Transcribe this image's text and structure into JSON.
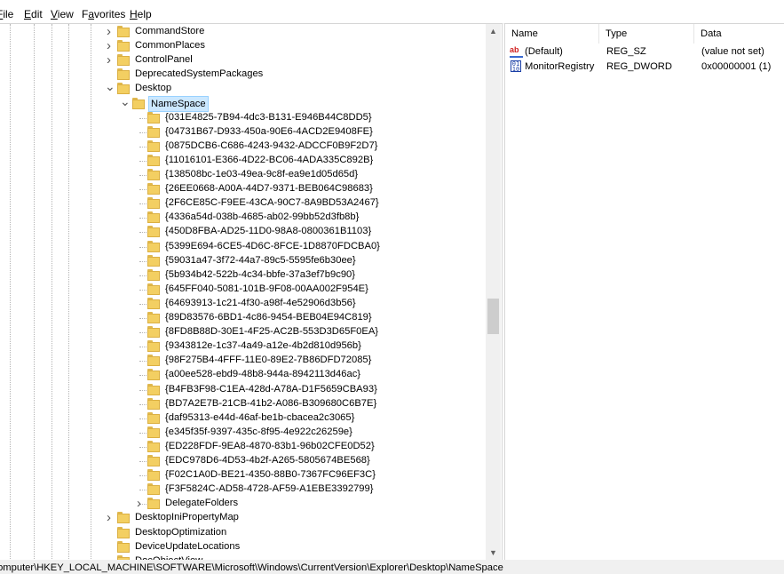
{
  "menu": [
    {
      "label": "File",
      "accel": "F"
    },
    {
      "label": "Edit",
      "accel": "E"
    },
    {
      "label": "View",
      "accel": "V"
    },
    {
      "label": "Favorites",
      "accel": "a"
    },
    {
      "label": "Help",
      "accel": "H"
    }
  ],
  "tree": {
    "items": [
      {
        "label": "CommandStore",
        "level": 0,
        "expander": "collapsed"
      },
      {
        "label": "CommonPlaces",
        "level": 0,
        "expander": "collapsed"
      },
      {
        "label": "ControlPanel",
        "level": 0,
        "expander": "collapsed"
      },
      {
        "label": "DeprecatedSystemPackages",
        "level": 0,
        "expander": "none"
      },
      {
        "label": "Desktop",
        "level": 0,
        "expander": "expanded"
      },
      {
        "label": "NameSpace",
        "level": 1,
        "expander": "expanded",
        "selected": true
      },
      {
        "label": "{031E4825-7B94-4dc3-B131-E946B44C8DD5}",
        "level": 2,
        "expander": "none"
      },
      {
        "label": "{04731B67-D933-450a-90E6-4ACD2E9408FE}",
        "level": 2,
        "expander": "none"
      },
      {
        "label": "{0875DCB6-C686-4243-9432-ADCCF0B9F2D7}",
        "level": 2,
        "expander": "none"
      },
      {
        "label": "{11016101-E366-4D22-BC06-4ADA335C892B}",
        "level": 2,
        "expander": "none"
      },
      {
        "label": "{138508bc-1e03-49ea-9c8f-ea9e1d05d65d}",
        "level": 2,
        "expander": "none"
      },
      {
        "label": "{26EE0668-A00A-44D7-9371-BEB064C98683}",
        "level": 2,
        "expander": "none"
      },
      {
        "label": "{2F6CE85C-F9EE-43CA-90C7-8A9BD53A2467}",
        "level": 2,
        "expander": "none"
      },
      {
        "label": "{4336a54d-038b-4685-ab02-99bb52d3fb8b}",
        "level": 2,
        "expander": "none"
      },
      {
        "label": "{450D8FBA-AD25-11D0-98A8-0800361B1103}",
        "level": 2,
        "expander": "none"
      },
      {
        "label": "{5399E694-6CE5-4D6C-8FCE-1D8870FDCBA0}",
        "level": 2,
        "expander": "none"
      },
      {
        "label": "{59031a47-3f72-44a7-89c5-5595fe6b30ee}",
        "level": 2,
        "expander": "none"
      },
      {
        "label": "{5b934b42-522b-4c34-bbfe-37a3ef7b9c90}",
        "level": 2,
        "expander": "none"
      },
      {
        "label": "{645FF040-5081-101B-9F08-00AA002F954E}",
        "level": 2,
        "expander": "none"
      },
      {
        "label": "{64693913-1c21-4f30-a98f-4e52906d3b56}",
        "level": 2,
        "expander": "none"
      },
      {
        "label": "{89D83576-6BD1-4c86-9454-BEB04E94C819}",
        "level": 2,
        "expander": "none"
      },
      {
        "label": "{8FD8B88D-30E1-4F25-AC2B-553D3D65F0EA}",
        "level": 2,
        "expander": "none"
      },
      {
        "label": "{9343812e-1c37-4a49-a12e-4b2d810d956b}",
        "level": 2,
        "expander": "none"
      },
      {
        "label": "{98F275B4-4FFF-11E0-89E2-7B86DFD72085}",
        "level": 2,
        "expander": "none"
      },
      {
        "label": "{a00ee528-ebd9-48b8-944a-8942113d46ac}",
        "level": 2,
        "expander": "none"
      },
      {
        "label": "{B4FB3F98-C1EA-428d-A78A-D1F5659CBA93}",
        "level": 2,
        "expander": "none"
      },
      {
        "label": "{BD7A2E7B-21CB-41b2-A086-B309680C6B7E}",
        "level": 2,
        "expander": "none"
      },
      {
        "label": "{daf95313-e44d-46af-be1b-cbacea2c3065}",
        "level": 2,
        "expander": "none"
      },
      {
        "label": "{e345f35f-9397-435c-8f95-4e922c26259e}",
        "level": 2,
        "expander": "none"
      },
      {
        "label": "{ED228FDF-9EA8-4870-83b1-96b02CFE0D52}",
        "level": 2,
        "expander": "none"
      },
      {
        "label": "{EDC978D6-4D53-4b2f-A265-5805674BE568}",
        "level": 2,
        "expander": "none"
      },
      {
        "label": "{F02C1A0D-BE21-4350-88B0-7367FC96EF3C}",
        "level": 2,
        "expander": "none"
      },
      {
        "label": "{F3F5824C-AD58-4728-AF59-A1EBE3392799}",
        "level": 2,
        "expander": "none"
      },
      {
        "label": "DelegateFolders",
        "level": 2,
        "expander": "collapsed"
      },
      {
        "label": "DesktopIniPropertyMap",
        "level": 0,
        "expander": "collapsed"
      },
      {
        "label": "DesktopOptimization",
        "level": 0,
        "expander": "none"
      },
      {
        "label": "DeviceUpdateLocations",
        "level": 0,
        "expander": "none"
      },
      {
        "label": "DocObjectView",
        "level": 0,
        "expander": "none"
      }
    ]
  },
  "list": {
    "columns": [
      "Name",
      "Type",
      "Data"
    ],
    "rows": [
      {
        "icon": "reg-sz-icon",
        "name": "(Default)",
        "type": "REG_SZ",
        "data": "(value not set)"
      },
      {
        "icon": "reg-dword-icon",
        "name": "MonitorRegistry",
        "type": "REG_DWORD",
        "data": "0x00000001 (1)"
      }
    ]
  },
  "statusbar": {
    "path": "Computer\\HKEY_LOCAL_MACHINE\\SOFTWARE\\Microsoft\\Windows\\CurrentVersion\\Explorer\\Desktop\\NameSpace"
  },
  "scrollbar": {
    "position": 0.55,
    "visible_fraction": 0.07
  },
  "colors": {
    "selection": "#cce8ff",
    "folder": "#f3cf62",
    "scrollbar": "#f0f0f0"
  }
}
